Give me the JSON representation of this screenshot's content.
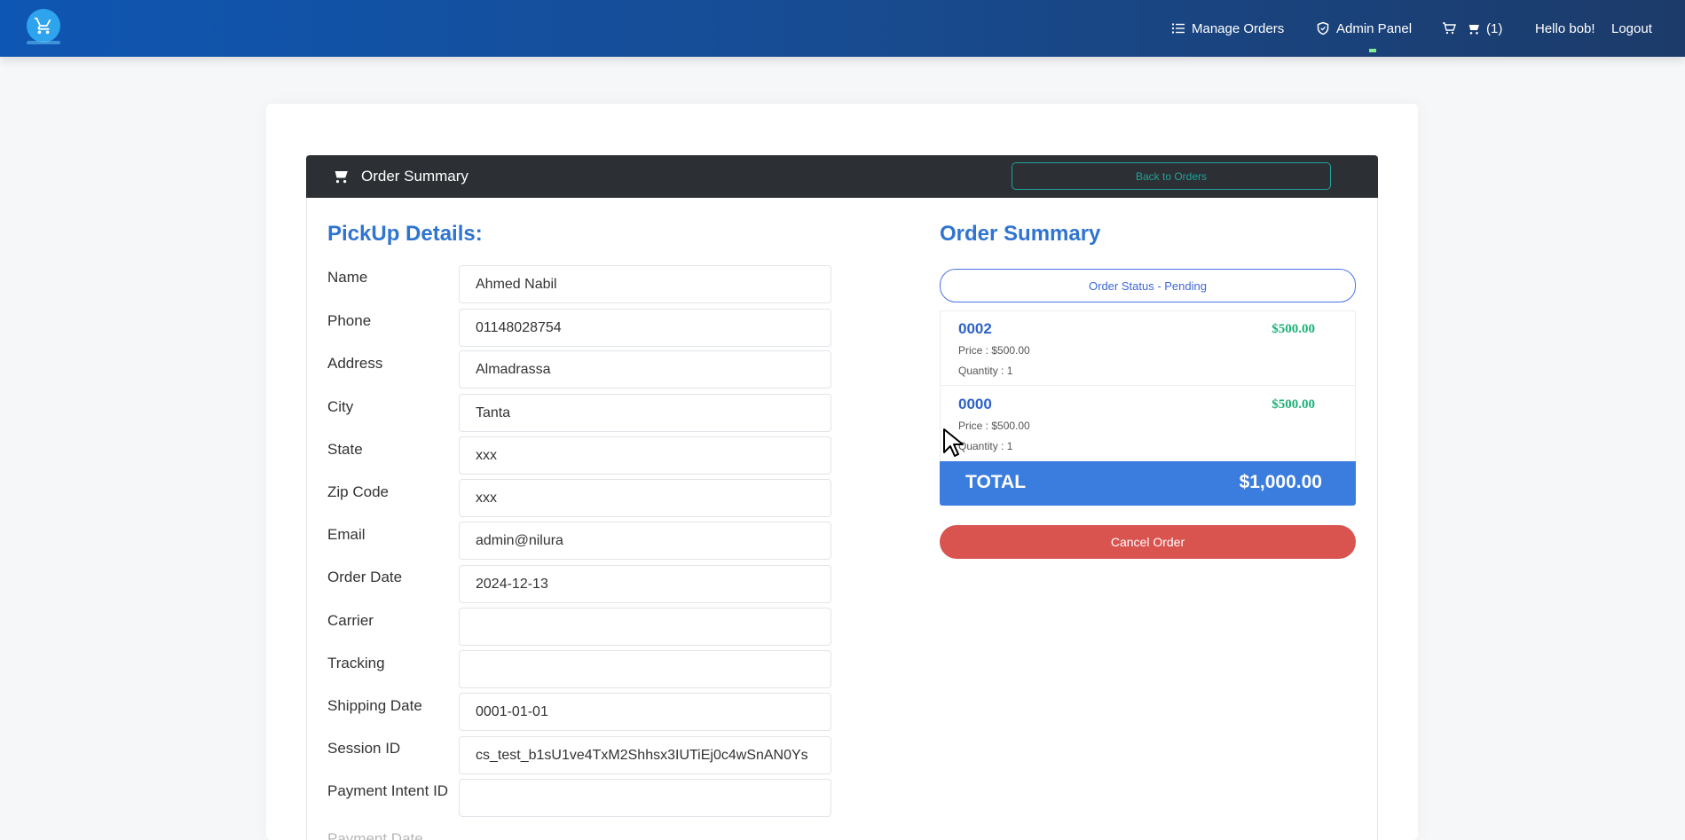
{
  "navbar": {
    "logo": "cart-logo-icon",
    "manage_orders": "Manage Orders",
    "admin_panel": "Admin Panel",
    "cart_count": "(1)",
    "greeting": "Hello bob!",
    "logout": "Logout"
  },
  "header": {
    "title": "Order Summary",
    "back_label": "Back to Orders"
  },
  "pickup": {
    "title": "PickUp Details:",
    "fields": [
      {
        "label": "Name",
        "value": "Ahmed  Nabil"
      },
      {
        "label": "Phone",
        "value": "01148028754"
      },
      {
        "label": "Address",
        "value": "Almadrassa"
      },
      {
        "label": "City",
        "value": "Tanta"
      },
      {
        "label": "State",
        "value": "xxx"
      },
      {
        "label": "Zip Code",
        "value": "xxx"
      },
      {
        "label": "Email",
        "value": "admin@nilura"
      },
      {
        "label": "Order Date",
        "value": "2024-12-13"
      },
      {
        "label": "Carrier",
        "value": ""
      },
      {
        "label": "Tracking",
        "value": ""
      },
      {
        "label": "Shipping Date",
        "value": "0001-01-01"
      },
      {
        "label": "Session ID",
        "value": "cs_test_b1sU1ve4TxM2Shhsx3IUTiEj0c4wSnAN0Ys"
      },
      {
        "label": "Payment Intent ID",
        "value": ""
      }
    ],
    "cut_label": "Payment Date"
  },
  "summary": {
    "title": "Order Summary",
    "status": "Order Status - Pending",
    "items": [
      {
        "name": "0002",
        "total": "$500.00",
        "price": "Price : $500.00",
        "quantity": "Quantity : 1"
      },
      {
        "name": "0000",
        "total": "$500.00",
        "price": "Price : $500.00",
        "quantity": "Quantity : 1"
      }
    ],
    "total_label": "TOTAL",
    "total_value": "$1,000.00",
    "cancel_label": "Cancel Order"
  },
  "colors": {
    "navbar_start": "#0e56b3",
    "navbar_end": "#1c3b6a",
    "accent_blue": "#2f74d0",
    "total_bar": "#3a7ddf",
    "cancel": "#d9534f",
    "item_price_green": "#1fb27a",
    "header_dark": "#2c3034"
  }
}
